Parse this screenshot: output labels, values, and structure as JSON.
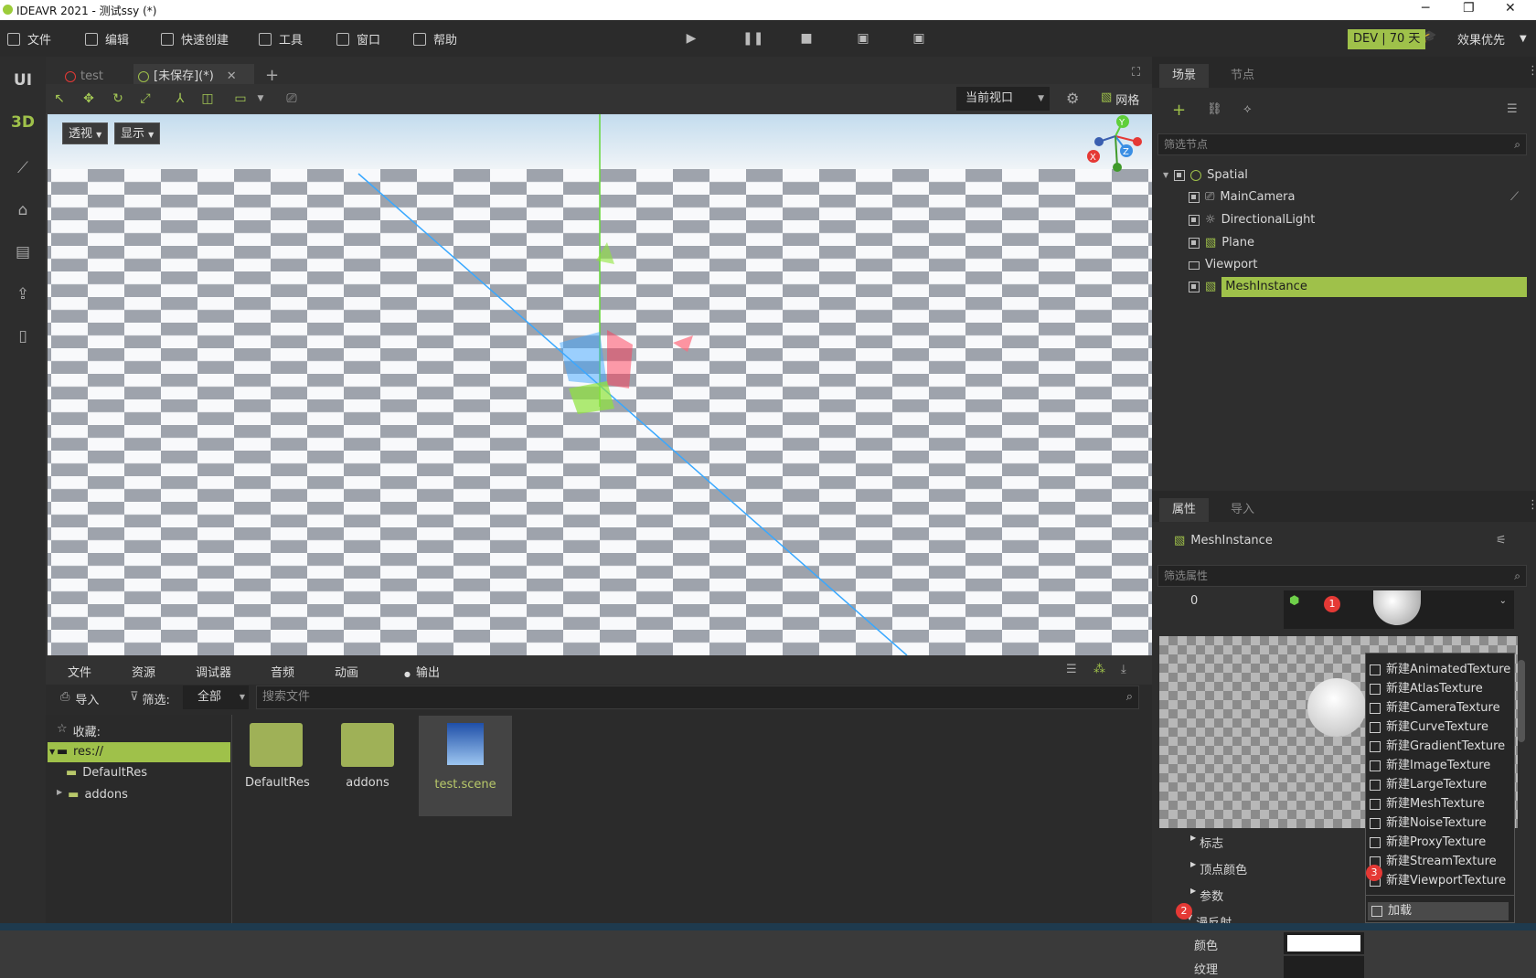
{
  "window": {
    "title": "IDEAVR 2021 - 测试ssy (*)",
    "minimize": "─",
    "maximize": "❐",
    "close": "✕"
  },
  "menubar": {
    "items": [
      "文件",
      "编辑",
      "快速创建",
      "工具",
      "窗口",
      "帮助"
    ],
    "dev_badge": "DEV | 70 天",
    "quality": "效果优先"
  },
  "leftbar": {
    "ui": "UI",
    "three_d": "3D"
  },
  "editor_tabs": [
    {
      "label": "test",
      "color": "#e53935"
    },
    {
      "label": "[未保存](*)",
      "color": "#9fc14a"
    }
  ],
  "toolbar": {
    "view_select": "当前视口",
    "grid": "网格"
  },
  "viewport": {
    "perspective": "透视",
    "display": "显示",
    "gizmo": {
      "x": "X",
      "y": "Y",
      "z": "Z"
    }
  },
  "bottom": {
    "tabs": [
      "文件",
      "资源",
      "调试器",
      "音频",
      "动画",
      "输出"
    ],
    "import": "导入",
    "filter_label": "筛选:",
    "filter_value": "全部",
    "search_placeholder": "搜索文件",
    "favorites": "收藏:",
    "tree": [
      "res://",
      "DefaultRes",
      "addons"
    ],
    "files": [
      "DefaultRes",
      "addons",
      "test.scene"
    ]
  },
  "scene_panel": {
    "tabs": [
      "场景",
      "节点"
    ],
    "filter_placeholder": "筛选节点",
    "nodes": [
      "Spatial",
      "MainCamera",
      "DirectionalLight",
      "Plane",
      "Viewport",
      "MeshInstance"
    ]
  },
  "props_panel": {
    "tabs": [
      "属性",
      "导入"
    ],
    "node_name": "MeshInstance",
    "filter_placeholder": "筛选属性",
    "index": "0",
    "sections": [
      "标志",
      "顶点颜色",
      "参数",
      "漫反射"
    ],
    "color_label": "颜色",
    "texture_label": "纹理"
  },
  "context_menu": {
    "items": [
      "新建AnimatedTexture",
      "新建AtlasTexture",
      "新建CameraTexture",
      "新建CurveTexture",
      "新建GradientTexture",
      "新建ImageTexture",
      "新建LargeTexture",
      "新建MeshTexture",
      "新建NoiseTexture",
      "新建ProxyTexture",
      "新建StreamTexture",
      "新建ViewportTexture"
    ],
    "load": "加载"
  },
  "badges": [
    "1",
    "2",
    "3"
  ]
}
